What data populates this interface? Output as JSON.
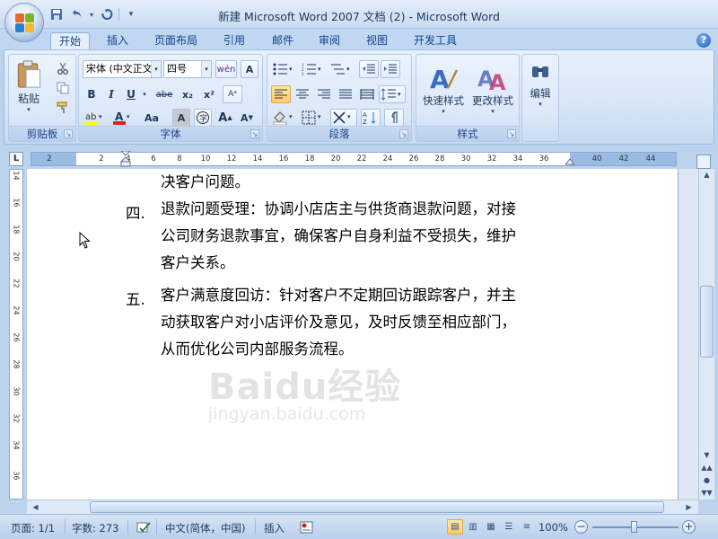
{
  "window": {
    "title": "新建 Microsoft Word 2007 文档 (2) - Microsoft Word"
  },
  "qat": {
    "save": "save-icon",
    "undo": "undo-icon",
    "redo": "redo-icon",
    "customize": "▾"
  },
  "tabs": [
    {
      "label": "开始",
      "active": true
    },
    {
      "label": "插入"
    },
    {
      "label": "页面布局"
    },
    {
      "label": "引用"
    },
    {
      "label": "邮件"
    },
    {
      "label": "审阅"
    },
    {
      "label": "视图"
    },
    {
      "label": "开发工具"
    }
  ],
  "ribbon": {
    "clipboard": {
      "label": "剪贴板",
      "paste_label": "粘贴"
    },
    "font": {
      "label": "字体",
      "font_name": "宋体 (中文正文)",
      "font_size": "四号",
      "buttons": [
        "B",
        "I",
        "U",
        "abe",
        "x₂",
        "x²",
        "Aa"
      ]
    },
    "paragraph": {
      "label": "段落"
    },
    "styles": {
      "label": "样式",
      "quick_styles_label": "快速样式",
      "change_styles_label": "更改样式"
    },
    "editing": {
      "label": "编辑"
    }
  },
  "ruler": {
    "corner": "L",
    "ticks": [
      "2",
      "2",
      "4",
      "6",
      "8",
      "10",
      "12",
      "14",
      "16",
      "18",
      "20",
      "22",
      "24",
      "26",
      "28",
      "30",
      "32",
      "34",
      "36",
      "40",
      "42",
      "44"
    ],
    "vticks": [
      "14",
      "16",
      "18",
      "20",
      "22",
      "24",
      "26",
      "28",
      "30",
      "32",
      "34",
      "36"
    ]
  },
  "document": {
    "lines": [
      {
        "num": "",
        "text": "决客户问题。"
      },
      {
        "num": "四.",
        "text": "退款问题受理：协调小店店主与供货商退款问题，对接"
      },
      {
        "num": "",
        "text": "公司财务退款事宜，确保客户自身利益不受损失，维护"
      },
      {
        "num": "",
        "text": "客户关系。"
      },
      {
        "num": "五.",
        "text": "客户满意度回访：针对客户不定期回访跟踪客户，并主"
      },
      {
        "num": "",
        "text": "动获取客户对小店评价及意见，及时反馈至相应部门，"
      },
      {
        "num": "",
        "text": "从而优化公司内部服务流程。"
      }
    ],
    "watermark": {
      "logo": "Baidu经验",
      "url": "jingyan.baidu.com"
    }
  },
  "statusbar": {
    "page": "页面: 1/1",
    "words": "字数: 273",
    "language": "中文(简体，中国)",
    "insert": "插入",
    "zoom": "100%",
    "zoom_level": 1.0
  },
  "colors": {
    "accent": "#15428b",
    "ribbon_bg": "#dbe8f8",
    "active_button": "#ffcb6b"
  }
}
